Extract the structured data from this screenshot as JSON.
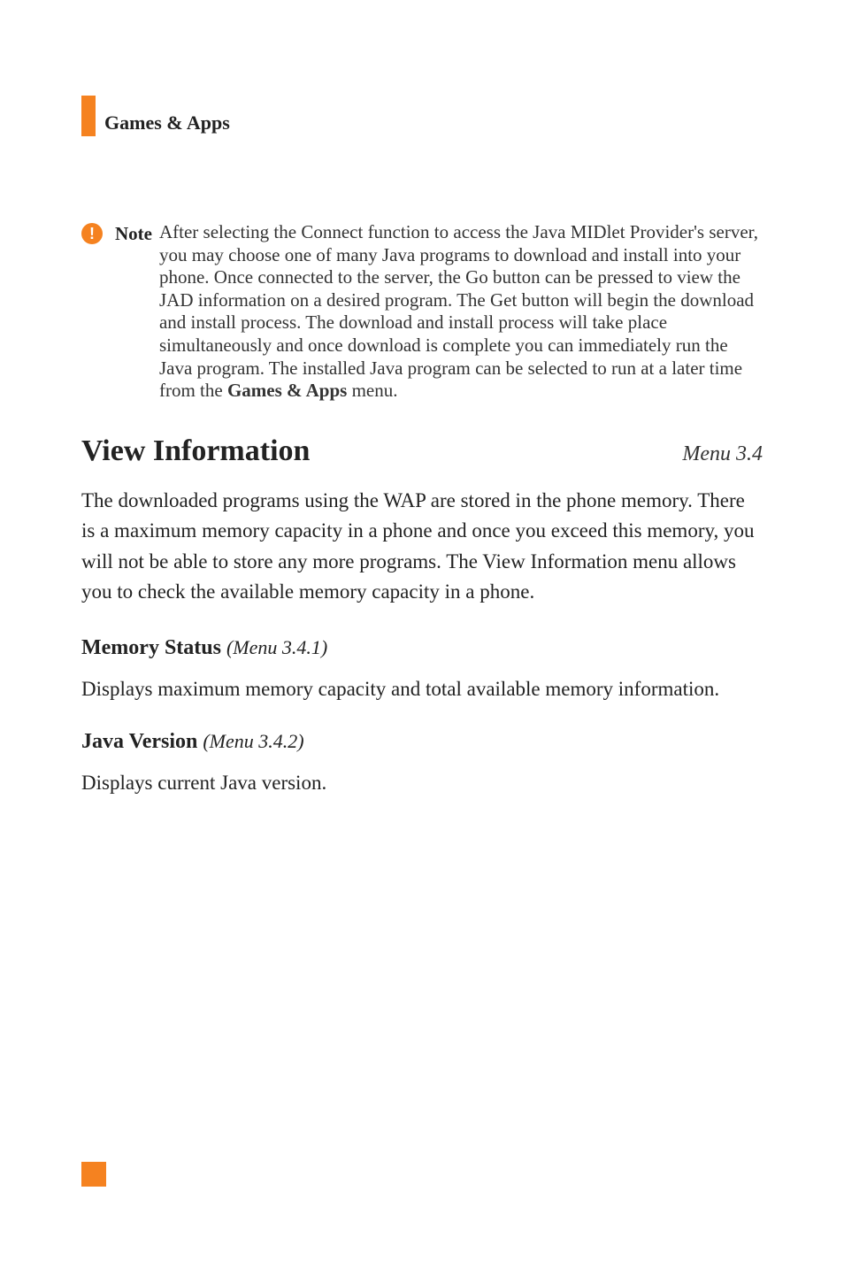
{
  "header": {
    "title": "Games & Apps"
  },
  "note": {
    "label": "Note",
    "text_prefix": "After selecting the Connect function to access the Java MIDlet Provider's server, you may choose one of many Java programs to download and install into your phone. Once connected to the server, the Go button can be pressed to view the JAD information on a desired program. The Get button will begin the download and install process. The download and install process will take place simultaneously and once download is complete you can immediately run the Java program. The installed Java program can be selected to run at a later time from the ",
    "bold_part": "Games & Apps",
    "text_suffix": " menu."
  },
  "section": {
    "title": "View Information",
    "menu": "Menu 3.4",
    "body": "The downloaded programs using the WAP are stored in the phone memory. There is a maximum memory capacity in a phone and once you exceed this memory, you will not be able to store any more programs. The View Information menu allows you to check the available memory capacity in a phone."
  },
  "sub1": {
    "title": "Memory Status",
    "menu": "(Menu 3.4.1)",
    "body": "Displays maximum memory capacity and total available memory information."
  },
  "sub2": {
    "title": "Java Version",
    "menu": "(Menu 3.4.2)",
    "body": "Displays current Java version."
  }
}
